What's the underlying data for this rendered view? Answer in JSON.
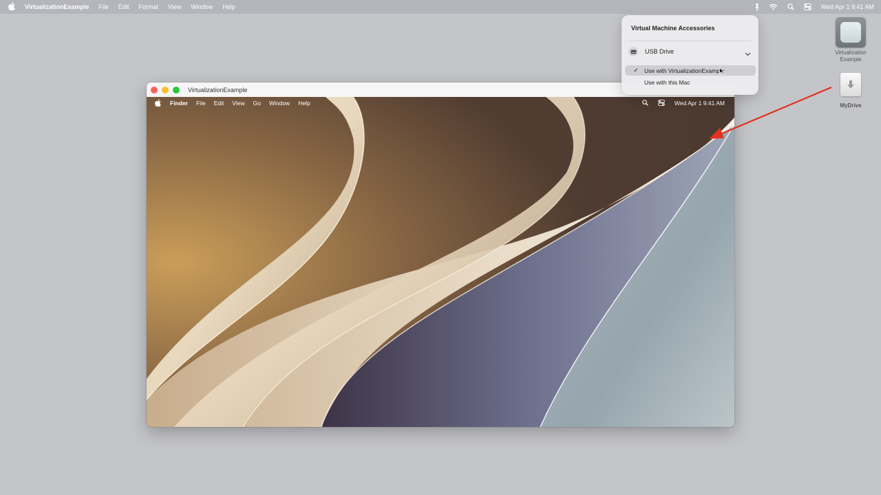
{
  "host_menubar": {
    "app": "VirtualizationExample",
    "menus": [
      "File",
      "Edit",
      "Format",
      "View",
      "Window",
      "Help"
    ],
    "datetime": "Wed Apr 1  9:41 AM",
    "icons": [
      "apple-logo",
      "usb-icon",
      "wifi-icon",
      "search-icon",
      "control-center-icon"
    ]
  },
  "vm_window": {
    "title": "VirtualizationExample",
    "traffic_colors": [
      "#ff5f57",
      "#febc2e",
      "#28c840"
    ]
  },
  "vm_menubar": {
    "app": "Finder",
    "menus": [
      "File",
      "Edit",
      "View",
      "Go",
      "Window",
      "Help"
    ],
    "datetime": "Wed Apr 1  9:41 AM",
    "icons": [
      "apple-logo",
      "search-icon",
      "control-center-icon"
    ]
  },
  "popover": {
    "title": "Virtual Machine Accessories",
    "device": "USB Drive",
    "options": [
      {
        "label": "Use with VirtualizationExample",
        "checked": true
      },
      {
        "label": "Use with this Mac",
        "checked": false
      }
    ],
    "check_glyph": "✓"
  },
  "desktop_icons": [
    {
      "label": "Virtualization Example",
      "kind": "app-icon"
    },
    {
      "label": "MyDrive",
      "kind": "drive-icon"
    }
  ],
  "annotation": {
    "color": "#e0321f"
  }
}
